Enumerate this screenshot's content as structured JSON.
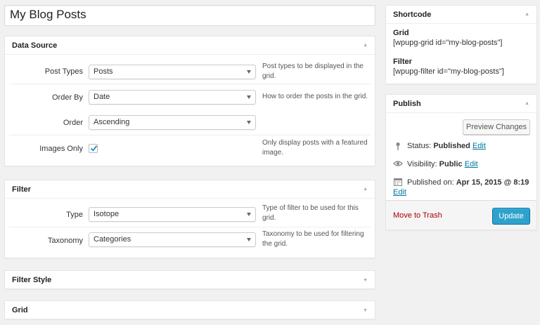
{
  "post": {
    "title": "My Blog Posts"
  },
  "data_source": {
    "title": "Data Source",
    "post_types": {
      "label": "Post Types",
      "value": "Posts",
      "desc": "Post types to be displayed in the grid."
    },
    "order_by": {
      "label": "Order By",
      "value": "Date",
      "desc": "How to order the posts in the grid."
    },
    "order": {
      "label": "Order",
      "value": "Ascending"
    },
    "images_only": {
      "label": "Images Only",
      "checked": true,
      "desc": "Only display posts with a featured image."
    }
  },
  "filter": {
    "title": "Filter",
    "type": {
      "label": "Type",
      "value": "Isotope",
      "desc": "Type of filter to be used for this grid."
    },
    "taxonomy": {
      "label": "Taxonomy",
      "value": "Categories",
      "desc": "Taxonomy to be used for filtering the grid."
    }
  },
  "filter_style": {
    "title": "Filter Style"
  },
  "grid": {
    "title": "Grid"
  },
  "shortcode": {
    "title": "Shortcode",
    "grid_label": "Grid",
    "grid_code": "[wpupg-grid id=\"my-blog-posts\"]",
    "filter_label": "Filter",
    "filter_code": "[wpupg-filter id=\"my-blog-posts\"]"
  },
  "publish": {
    "title": "Publish",
    "preview_label": "Preview Changes",
    "status_label": "Status:",
    "status_value": "Published",
    "visibility_label": "Visibility:",
    "visibility_value": "Public",
    "published_label": "Published on:",
    "published_value": "Apr 15, 2015 @ 8:19",
    "edit_label": "Edit",
    "trash_label": "Move to Trash",
    "update_label": "Update"
  },
  "colors": {
    "primary": "#2ea2cc",
    "link": "#0074a2",
    "trash": "#aa0000"
  }
}
